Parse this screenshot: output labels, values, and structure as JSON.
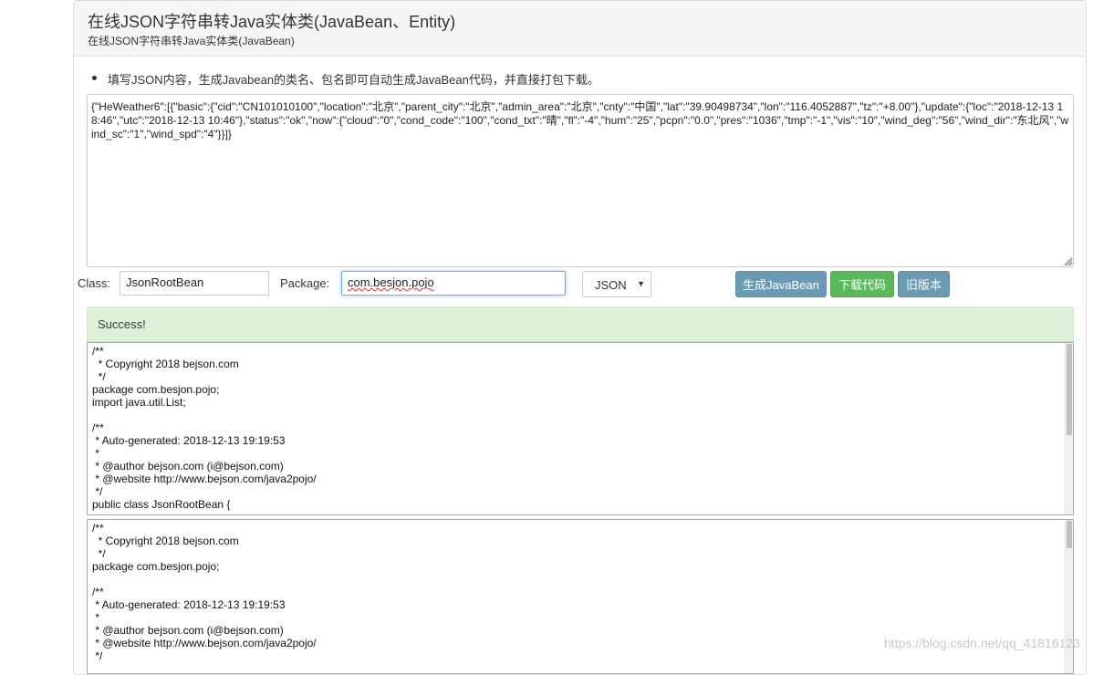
{
  "header": {
    "title": "在线JSON字符串转Java实体类(JavaBean、Entity)",
    "subtitle": "在线JSON字符串转Java实体类(JavaBean)"
  },
  "instructions": "填写JSON内容，生成Javabean的类名、包名即可自动生成JavaBean代码，并直接打包下载。",
  "json_input": "{\"HeWeather6\":[{\"basic\":{\"cid\":\"CN101010100\",\"location\":\"北京\",\"parent_city\":\"北京\",\"admin_area\":\"北京\",\"cnty\":\"中国\",\"lat\":\"39.90498734\",\"lon\":\"116.4052887\",\"tz\":\"+8.00\"},\"update\":{\"loc\":\"2018-12-13 18:46\",\"utc\":\"2018-12-13 10:46\"},\"status\":\"ok\",\"now\":{\"cloud\":\"0\",\"cond_code\":\"100\",\"cond_txt\":\"晴\",\"fl\":\"-4\",\"hum\":\"25\",\"pcpn\":\"0.0\",\"pres\":\"1036\",\"tmp\":\"-1\",\"vis\":\"10\",\"wind_deg\":\"56\",\"wind_dir\":\"东北风\",\"wind_sc\":\"1\",\"wind_spd\":\"4\"}}]}",
  "form": {
    "class_label": "Class:",
    "class_value": "JsonRootBean",
    "package_label": "Package:",
    "package_value": "com.besjon.pojo",
    "format_selected": "JSON",
    "generate_button": "生成JavaBean",
    "download_button": "下载代码",
    "old_version_button": "旧版本"
  },
  "alert": "Success!",
  "code_outputs": [
    "/**\n  * Copyright 2018 bejson.com\n  */\npackage com.besjon.pojo;\nimport java.util.List;\n\n/**\n * Auto-generated: 2018-12-13 19:19:53\n *\n * @author bejson.com (i@bejson.com)\n * @website http://www.bejson.com/java2pojo/\n */\npublic class JsonRootBean {",
    "/**\n  * Copyright 2018 bejson.com\n  */\npackage com.besjon.pojo;\n\n/**\n * Auto-generated: 2018-12-13 19:19:53\n *\n * @author bejson.com (i@bejson.com)\n * @website http://www.bejson.com/java2pojo/\n */"
  ],
  "watermark": "https://blog.csdn.net/qq_41816123",
  "colors": {
    "primary_button": "#6a9ab5",
    "success_button": "#5cb85c",
    "alert_bg": "#dff0d8"
  }
}
